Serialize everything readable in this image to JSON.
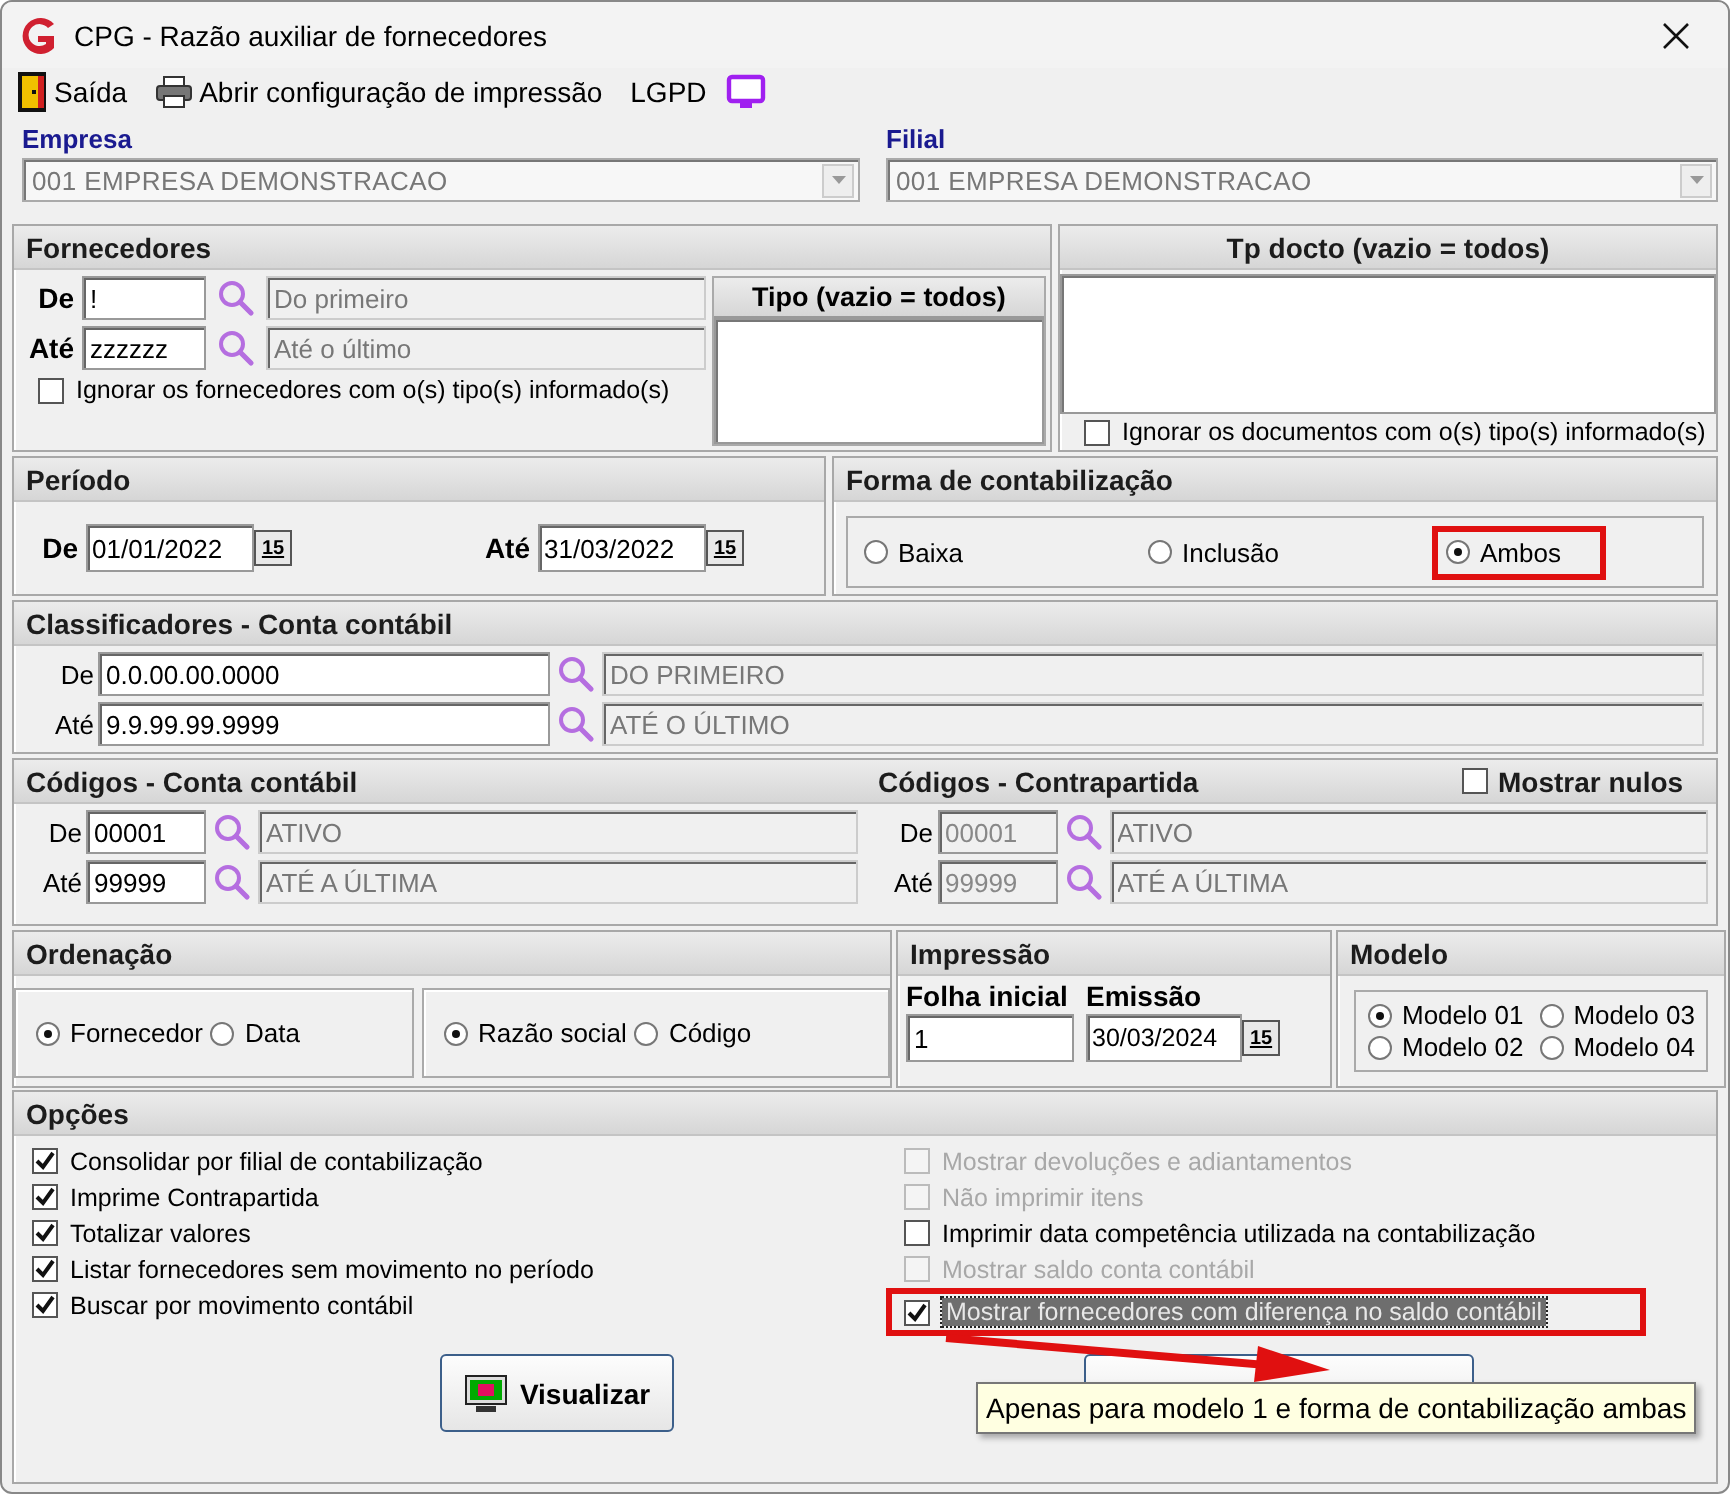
{
  "window": {
    "title": "CPG - Razão auxiliar de fornecedores"
  },
  "toolbar": [
    {
      "kind": "exit",
      "label": "Saída"
    },
    {
      "kind": "print",
      "label": "Abrir configuração de impressão"
    },
    {
      "kind": "lgpd",
      "label": "LGPD"
    }
  ],
  "empresa": {
    "label": "Empresa",
    "value": "001 EMPRESA DEMONSTRACAO"
  },
  "filial": {
    "label": "Filial",
    "value": "001 EMPRESA DEMONSTRACAO"
  },
  "fornecedores": {
    "title": "Fornecedores",
    "tipo_title": "Tipo (vazio = todos)",
    "rows": [
      {
        "label": "De",
        "value": "!",
        "description": "Do primeiro"
      },
      {
        "label": "Até",
        "value": "zzzzzz",
        "description": "Até o último"
      }
    ],
    "ignore": {
      "label": "Ignorar os fornecedores com o(s) tipo(s) informado(s)",
      "checked": false
    }
  },
  "tp_docto": {
    "title": "Tp docto (vazio = todos)",
    "ignore": {
      "label": "Ignorar os documentos com o(s) tipo(s) informado(s)",
      "checked": false
    }
  },
  "periodo": {
    "title": "Período",
    "fields": [
      {
        "label": "De",
        "value": "01/01/2022",
        "button": "15"
      },
      {
        "label": "Até",
        "value": "31/03/2022",
        "button": "15"
      }
    ]
  },
  "forma": {
    "title": "Forma de contabilização",
    "options": [
      {
        "label": "Baixa",
        "selected": false,
        "highlighted": false
      },
      {
        "label": "Inclusão",
        "selected": false,
        "highlighted": false
      },
      {
        "label": "Ambos",
        "selected": true,
        "highlighted": true
      }
    ]
  },
  "classificadores": {
    "title": "Classificadores - Conta contábil",
    "rows": [
      {
        "label": "De",
        "value": "0.0.00.00.0000",
        "description": "DO PRIMEIRO",
        "disabled": false
      },
      {
        "label": "Até",
        "value": "9.9.99.99.9999",
        "description": "ATÉ O ÚLTIMO",
        "disabled": false
      }
    ]
  },
  "codigos": {
    "title": "Códigos - Conta contábil",
    "rows": [
      {
        "label": "De",
        "value": "00001",
        "description": "ATIVO",
        "disabled": false
      },
      {
        "label": "Até",
        "value": "99999",
        "description": "ATÉ A ÚLTIMA",
        "disabled": false
      }
    ]
  },
  "contrapartida": {
    "title": "Códigos - Contrapartida",
    "rows": [
      {
        "label": "De",
        "value": "00001",
        "description": "ATIVO",
        "disabled": true
      },
      {
        "label": "Até",
        "value": "99999",
        "description": "ATÉ A ÚLTIMA",
        "disabled": true
      }
    ],
    "mostrar_nulos": {
      "label": "Mostrar nulos",
      "checked": false
    }
  },
  "ordenacao": {
    "title": "Ordenação",
    "groups": [
      {
        "options": [
          {
            "label": "Fornecedor",
            "selected": true
          },
          {
            "label": "Data",
            "selected": false
          }
        ]
      },
      {
        "options": [
          {
            "label": "Razão social",
            "selected": true
          },
          {
            "label": "Código",
            "selected": false
          }
        ]
      }
    ]
  },
  "impressao": {
    "title": "Impressão",
    "folha": {
      "label": "Folha inicial",
      "value": "1"
    },
    "emissao": {
      "label": "Emissão",
      "value": "30/03/2024",
      "button": "15"
    }
  },
  "modelo": {
    "title": "Modelo",
    "options": [
      {
        "label": "Modelo 01",
        "selected": true
      },
      {
        "label": "Modelo 03",
        "selected": false
      },
      {
        "label": "Modelo 02",
        "selected": false
      },
      {
        "label": "Modelo 04",
        "selected": false
      }
    ]
  },
  "opcoes": {
    "title": "Opções",
    "left": [
      {
        "label": "Consolidar por filial de contabilização",
        "checked": true,
        "disabled": false,
        "focused": false,
        "highlighted": false
      },
      {
        "label": "Imprime Contrapartida",
        "checked": true,
        "disabled": false,
        "focused": false,
        "highlighted": false
      },
      {
        "label": "Totalizar valores",
        "checked": true,
        "disabled": false,
        "focused": false,
        "highlighted": false
      },
      {
        "label": "Listar fornecedores sem movimento no período",
        "checked": true,
        "disabled": false,
        "focused": false,
        "highlighted": false
      },
      {
        "label": "Buscar por movimento contábil",
        "checked": true,
        "disabled": false,
        "focused": false,
        "highlighted": false
      }
    ],
    "right": [
      {
        "label": "Mostrar devoluções e adiantamentos",
        "checked": false,
        "disabled": true,
        "focused": false,
        "highlighted": false
      },
      {
        "label": "Não imprimir itens",
        "checked": false,
        "disabled": true,
        "focused": false,
        "highlighted": false
      },
      {
        "label": "Imprimir data competência utilizada na contabilização",
        "checked": false,
        "disabled": false,
        "focused": false,
        "highlighted": false
      },
      {
        "label": "Mostrar saldo conta contábil",
        "checked": false,
        "disabled": true,
        "focused": false,
        "highlighted": false
      },
      {
        "label": "Mostrar fornecedores com diferença no saldo contábil",
        "checked": true,
        "disabled": false,
        "focused": true,
        "highlighted": true
      }
    ]
  },
  "buttons": [
    {
      "kind": "preview",
      "label": "Visualizar"
    },
    {
      "kind": "print"
    }
  ],
  "tooltip": {
    "text": "Apenas para modelo 1 e forma de contabilização ambas"
  }
}
